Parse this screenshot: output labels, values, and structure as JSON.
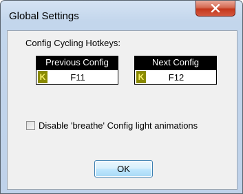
{
  "window": {
    "title": "Global Settings"
  },
  "controls": {
    "close_icon": "close-icon"
  },
  "section": {
    "heading": "Config Cycling Hotkeys:"
  },
  "hotkeys": [
    {
      "label": "Previous Config",
      "value": "F11",
      "icon": "K"
    },
    {
      "label": "Next Config",
      "value": "F12",
      "icon": "K"
    }
  ],
  "options": {
    "breathe_label": "Disable 'breathe' Config light animations",
    "breathe_checked": false
  },
  "buttons": {
    "ok": "OK"
  },
  "colors": {
    "titlebar": "#c3d6ec",
    "close_button": "#c4381d",
    "hotkey_header": "#000000",
    "hotkey_icon_bg": "#8a8a00",
    "hotkey_icon_fg": "#f6ef6a",
    "ok_border": "#3c7fb1"
  }
}
